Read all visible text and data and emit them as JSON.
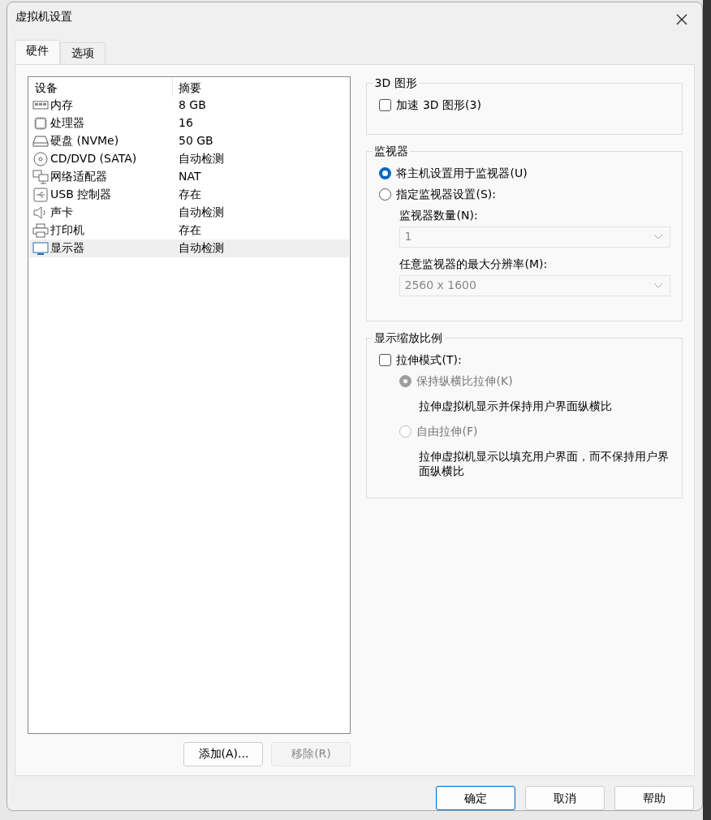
{
  "window": {
    "title": "虚拟机设置"
  },
  "tabs": [
    {
      "label": "硬件",
      "selected": true
    },
    {
      "label": "选项",
      "selected": false
    }
  ],
  "device_table": {
    "columns": [
      "设备",
      "摘要"
    ],
    "rows": [
      {
        "kind": "memory",
        "device": "内存",
        "summary": "8 GB",
        "selected": false
      },
      {
        "kind": "cpu",
        "device": "处理器",
        "summary": "16",
        "selected": false
      },
      {
        "kind": "disk",
        "device": "硬盘 (NVMe)",
        "summary": "50 GB",
        "selected": false
      },
      {
        "kind": "cdrom",
        "device": "CD/DVD (SATA)",
        "summary": "自动检测",
        "selected": false
      },
      {
        "kind": "network",
        "device": "网络适配器",
        "summary": "NAT",
        "selected": false
      },
      {
        "kind": "usb",
        "device": "USB 控制器",
        "summary": "存在",
        "selected": false
      },
      {
        "kind": "sound",
        "device": "声卡",
        "summary": "自动检测",
        "selected": false
      },
      {
        "kind": "printer",
        "device": "打印机",
        "summary": "存在",
        "selected": false
      },
      {
        "kind": "display",
        "device": "显示器",
        "summary": "自动检测",
        "selected": true
      }
    ]
  },
  "list_buttons": [
    {
      "label": "添加(A)...",
      "disabled": false
    },
    {
      "label": "移除(R)",
      "disabled": true
    }
  ],
  "graphics_3d": {
    "title": "3D 图形",
    "accelerate": {
      "label": "加速 3D 图形(3)",
      "checked": false
    }
  },
  "monitors": {
    "title": "监视器",
    "options": [
      {
        "label": "将主机设置用于监视器(U)",
        "selected": true
      },
      {
        "label": "指定监视器设置(S):",
        "selected": false
      }
    ],
    "count": {
      "label": "监视器数量(N):",
      "value": "1",
      "disabled": true
    },
    "resolution": {
      "label": "任意监视器的最大分辨率(M):",
      "value": "2560 x 1600",
      "disabled": true
    }
  },
  "scaling": {
    "title": "显示缩放比例",
    "stretch": {
      "label": "拉伸模式(T):",
      "checked": false
    },
    "options": [
      {
        "label": "保持纵横比拉伸(K)",
        "selected": true,
        "disabled": true,
        "description": "拉伸虚拟机显示并保持用户界面纵横比"
      },
      {
        "label": "自由拉伸(F)",
        "selected": false,
        "disabled": true,
        "description": "拉伸虚拟机显示以填充用户界面，而不保持用户界面纵横比"
      }
    ]
  },
  "footer_buttons": [
    {
      "label": "确定",
      "default": true
    },
    {
      "label": "取消",
      "default": false
    },
    {
      "label": "帮助",
      "default": false
    }
  ]
}
